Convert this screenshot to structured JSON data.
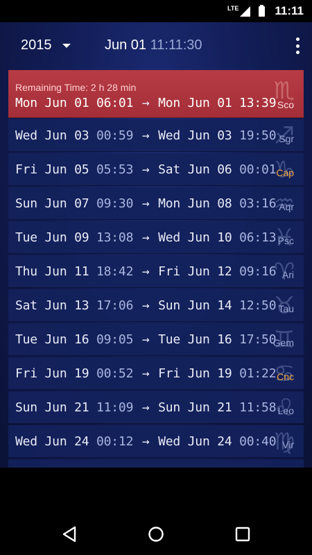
{
  "status": {
    "network": "LTE",
    "time": "11:11"
  },
  "toolbar": {
    "year": "2015",
    "date": "Jun 01",
    "time": "11:11:30"
  },
  "current": {
    "remaining": "Remaining Time: 2 h 28 min"
  },
  "rows": [
    {
      "from_date": "Mon Jun 01",
      "from_time": "06:01",
      "arrow": "→",
      "to_date": "Mon Jun 01",
      "to_time": "13:39",
      "glyph": "♏",
      "sign": "Sco"
    },
    {
      "from_date": "Wed Jun 03",
      "from_time": "00:59",
      "arrow": "→",
      "to_date": "Wed Jun 03",
      "to_time": "19:50",
      "glyph": "♐",
      "sign": "Sgr"
    },
    {
      "from_date": "Fri Jun 05",
      "from_time": "05:53",
      "arrow": "→",
      "to_date": "Sat Jun 06",
      "to_time": "00:01",
      "glyph": "♑",
      "sign": "Cap"
    },
    {
      "from_date": "Sun Jun 07",
      "from_time": "09:30",
      "arrow": "→",
      "to_date": "Mon Jun 08",
      "to_time": "03:16",
      "glyph": "♒",
      "sign": "Aqr"
    },
    {
      "from_date": "Tue Jun 09",
      "from_time": "13:08",
      "arrow": "→",
      "to_date": "Wed Jun 10",
      "to_time": "06:13",
      "glyph": "♓",
      "sign": "Psc"
    },
    {
      "from_date": "Thu Jun 11",
      "from_time": "18:42",
      "arrow": "→",
      "to_date": "Fri Jun 12",
      "to_time": "09:16",
      "glyph": "♈",
      "sign": "Ari"
    },
    {
      "from_date": "Sat Jun 13",
      "from_time": "17:06",
      "arrow": "→",
      "to_date": "Sun Jun 14",
      "to_time": "12:50",
      "glyph": "♉",
      "sign": "Tau"
    },
    {
      "from_date": "Tue Jun 16",
      "from_time": "09:05",
      "arrow": "→",
      "to_date": "Tue Jun 16",
      "to_time": "17:50",
      "glyph": "♊",
      "sign": "Gem"
    },
    {
      "from_date": "Fri Jun 19",
      "from_time": "00:52",
      "arrow": "→",
      "to_date": "Fri Jun 19",
      "to_time": "01:22",
      "glyph": "♋",
      "sign": "Cnc"
    },
    {
      "from_date": "Sun Jun 21",
      "from_time": "11:09",
      "arrow": "→",
      "to_date": "Sun Jun 21",
      "to_time": "11:58",
      "glyph": "♌",
      "sign": "Leo"
    },
    {
      "from_date": "Wed Jun 24",
      "from_time": "00:12",
      "arrow": "→",
      "to_date": "Wed Jun 24",
      "to_time": "00:40",
      "glyph": "♍",
      "sign": "Vir"
    }
  ],
  "colors": {
    "active_row": "#b73b44",
    "highlight_sign": "#f2a640",
    "row_bg": "#14225c"
  },
  "nav": {
    "back_icon": "back-triangle-icon",
    "home_icon": "home-circle-icon",
    "recents_icon": "recents-square-icon"
  }
}
